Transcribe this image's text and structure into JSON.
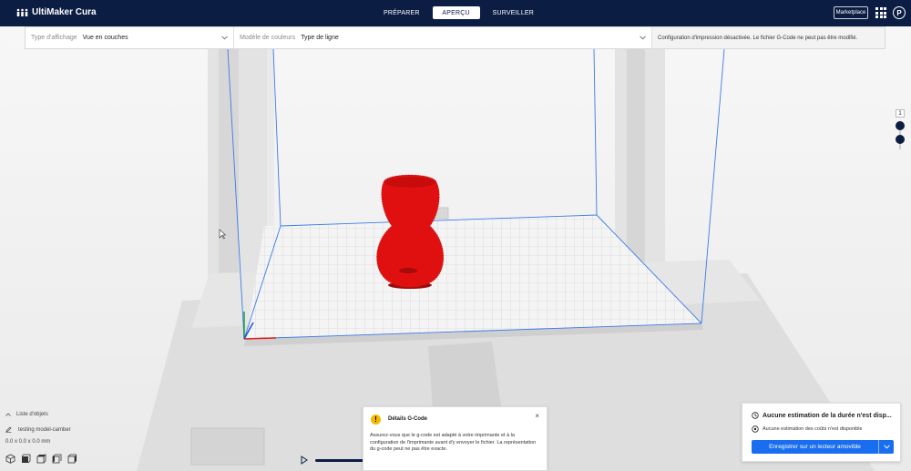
{
  "app": {
    "title": "UltiMaker Cura"
  },
  "stages": [
    {
      "label": "PRÉPARER",
      "active": false
    },
    {
      "label": "APERÇU",
      "active": true
    },
    {
      "label": "SURVEILLER",
      "active": false
    }
  ],
  "header": {
    "marketplace_label": "Marketplace",
    "avatar_initial": "P"
  },
  "view_bar": {
    "view_type_label": "Type d'affichage",
    "view_type_value": "Vue en couches",
    "color_scheme_label": "Modèle de couleurs",
    "color_scheme_value": "Type de ligne",
    "info": "Configuration d'impression désactivée. Le fichier G-Code ne peut pas être modifié."
  },
  "layer_slider": {
    "current_layer": "1"
  },
  "object_list": {
    "header": "Liste d'objets",
    "object_name": "testing model-camber",
    "dimensions": "0.0 x 0.0 x 0.0 mm"
  },
  "gcode_message": {
    "title": "Détails G-Code",
    "close": "×",
    "body": "Assurez-vous que le g-code est adapté à votre imprimante et à la configuration de l'imprimante avant d'y envoyer le fichier. La représentation du g-code peut ne pas être exacte."
  },
  "estimate": {
    "time": "Aucune estimation de la durée n'est disp...",
    "cost": "Aucune estimation des coûts n'est disponible",
    "save_button": "Enregistrer sur un lecteur amovible"
  },
  "colors": {
    "header_bg": "#0c1d44",
    "accent": "#196ef0",
    "model": "#e01010",
    "build_volume": "#3a7be8",
    "warning": "#f3ba00"
  }
}
